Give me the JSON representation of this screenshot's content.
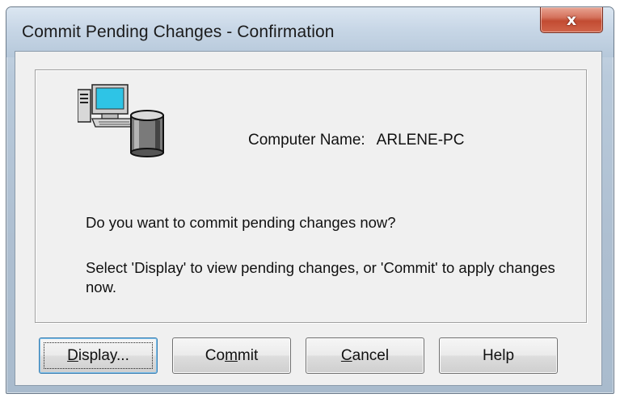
{
  "window": {
    "title": "Commit Pending Changes - Confirmation",
    "close_glyph": "x"
  },
  "dialog": {
    "computer_name_label": "Computer Name:",
    "computer_name_value": "ARLENE-PC",
    "question": "Do you want to commit pending changes now?",
    "instructions": "Select 'Display' to view pending changes, or 'Commit' to apply changes now.",
    "icon": "computer-database-icon"
  },
  "buttons": {
    "display": {
      "mnemonic": "D",
      "rest": "isplay..."
    },
    "commit": {
      "pre": "Co",
      "mnemonic": "m",
      "rest": "mit"
    },
    "cancel": {
      "mnemonic": "C",
      "rest": "ancel"
    },
    "help": {
      "label": "Help"
    }
  },
  "colors": {
    "close_button": "#c24b32",
    "dialog_face": "#f0f0f0",
    "monitor_screen": "#2ec4e6"
  }
}
